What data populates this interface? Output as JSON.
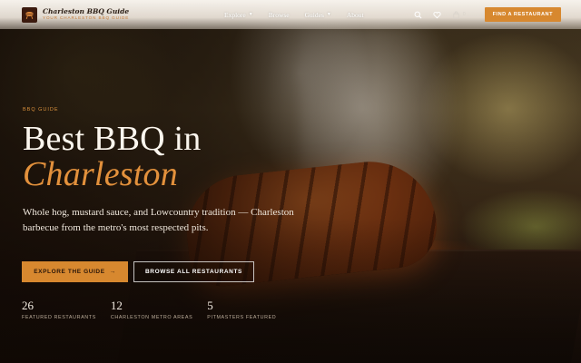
{
  "brand": {
    "logo_icon": "bbq-grill-icon",
    "title": "Charleston BBQ Guide",
    "subtitle": "YOUR CHARLESTON BBQ GUIDE"
  },
  "nav": {
    "items": [
      {
        "label": "Explore",
        "has_dropdown": true
      },
      {
        "label": "Browse",
        "has_dropdown": false
      },
      {
        "label": "Guides",
        "has_dropdown": true
      },
      {
        "label": "About",
        "has_dropdown": false
      }
    ],
    "cart_count": "0",
    "find_button": "FIND A RESTAURANT"
  },
  "hero": {
    "eyebrow": "BBQ GUIDE",
    "title_line1": "Best BBQ in",
    "title_line2": "Charleston",
    "lede": "Whole hog, mustard sauce, and Lowcountry tradition — Charleston barbecue from the metro's most respected pits.",
    "primary_cta": "EXPLORE THE GUIDE",
    "primary_cta_icon": "→",
    "secondary_cta": "BROWSE ALL RESTAURANTS"
  },
  "stats": [
    {
      "value": "26",
      "label": "FEATURED RESTAURANTS"
    },
    {
      "value": "12",
      "label": "CHARLESTON METRO AREAS"
    },
    {
      "value": "5",
      "label": "PITMASTERS FEATURED"
    }
  ],
  "colors": {
    "accent": "#d7882f",
    "accent_text": "#e3913c",
    "dark": "#1a120c"
  }
}
